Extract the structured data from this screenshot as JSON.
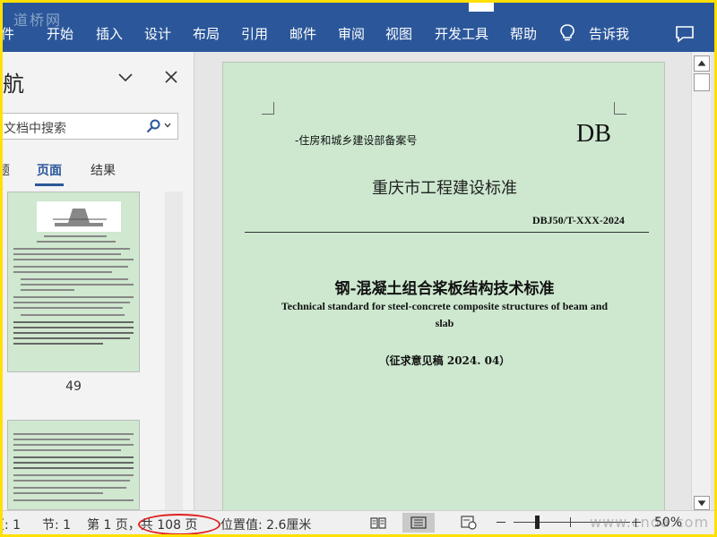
{
  "watermarks": {
    "top": "道桥网",
    "bottom": "www.cnda.com"
  },
  "ribbon": {
    "tabs": [
      "件",
      "开始",
      "插入",
      "设计",
      "布局",
      "引用",
      "邮件",
      "审阅",
      "视图",
      "开发工具",
      "帮助"
    ],
    "tell_me": "告诉我",
    "accent_color": "#2b579a"
  },
  "nav": {
    "title": "航",
    "search_placeholder": "文档中搜索",
    "tabs": {
      "headings": "题",
      "pages": "页面",
      "results": "结果"
    },
    "thumbnail_page_number": "49"
  },
  "document": {
    "filing": "-住房和城乡建设部备案号",
    "db_mark": "DB",
    "subtitle": "重庆市工程建设标准",
    "code": "DBJ50/T-XXX-2024",
    "title_cn": "钢-混凝土组合桨板结构技术标准",
    "title_en": "Technical standard for steel-concrete composite structures of beam and slab",
    "draft_note": "（征求意见稿 2024. 04）",
    "page_color": "#cde8cf"
  },
  "status": {
    "page_section": "页: 1",
    "section": "节: 1",
    "page_info": "第 1 页，共 108 页",
    "position": "位置值: 2.6厘米",
    "zoom": "50%"
  },
  "icons": {
    "tell_me": "lightbulb-icon",
    "comments": "comment-icon",
    "nav_dropdown": "chevron-down-icon",
    "nav_close": "close-icon",
    "search": "search-icon",
    "read_mode": "book-icon",
    "print_layout": "page-icon",
    "web_layout": "web-icon"
  }
}
